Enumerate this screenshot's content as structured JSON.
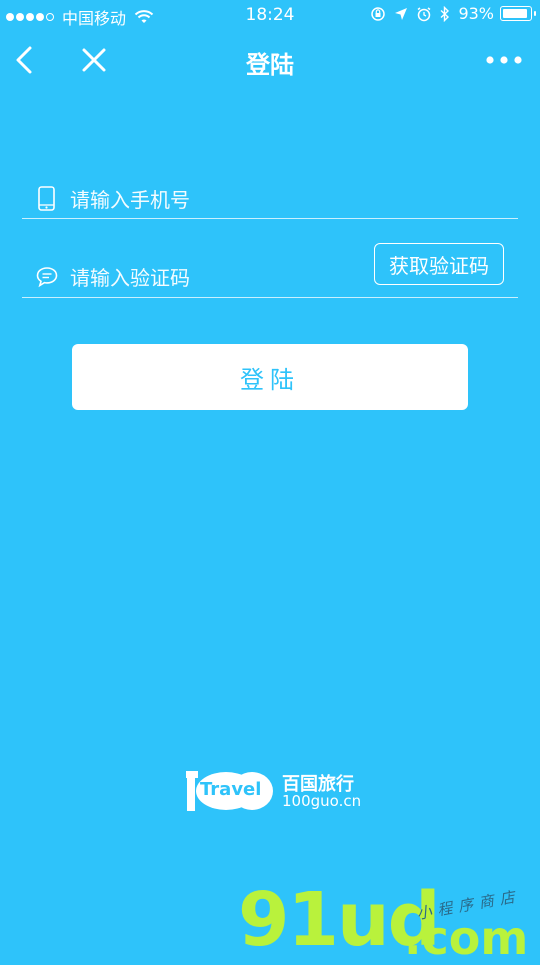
{
  "status_bar": {
    "carrier": "中国移动",
    "time": "18:24",
    "battery_percent_label": "93%",
    "battery_level": 0.93
  },
  "nav": {
    "title": "登陆"
  },
  "form": {
    "phone_placeholder": "请输入手机号",
    "code_placeholder": "请输入验证码",
    "get_code_label": "获取验证码",
    "login_label": "登陆"
  },
  "logo": {
    "mark_text": "Travel",
    "name": "百国旅行",
    "domain": "100guo.cn"
  },
  "watermark": {
    "main": "91ud",
    "suffix": ".com",
    "sub": "小程序商店"
  },
  "colors": {
    "background": "#2ec3fa",
    "button_text": "#2ec3fa",
    "watermark": "#b9f23c"
  }
}
